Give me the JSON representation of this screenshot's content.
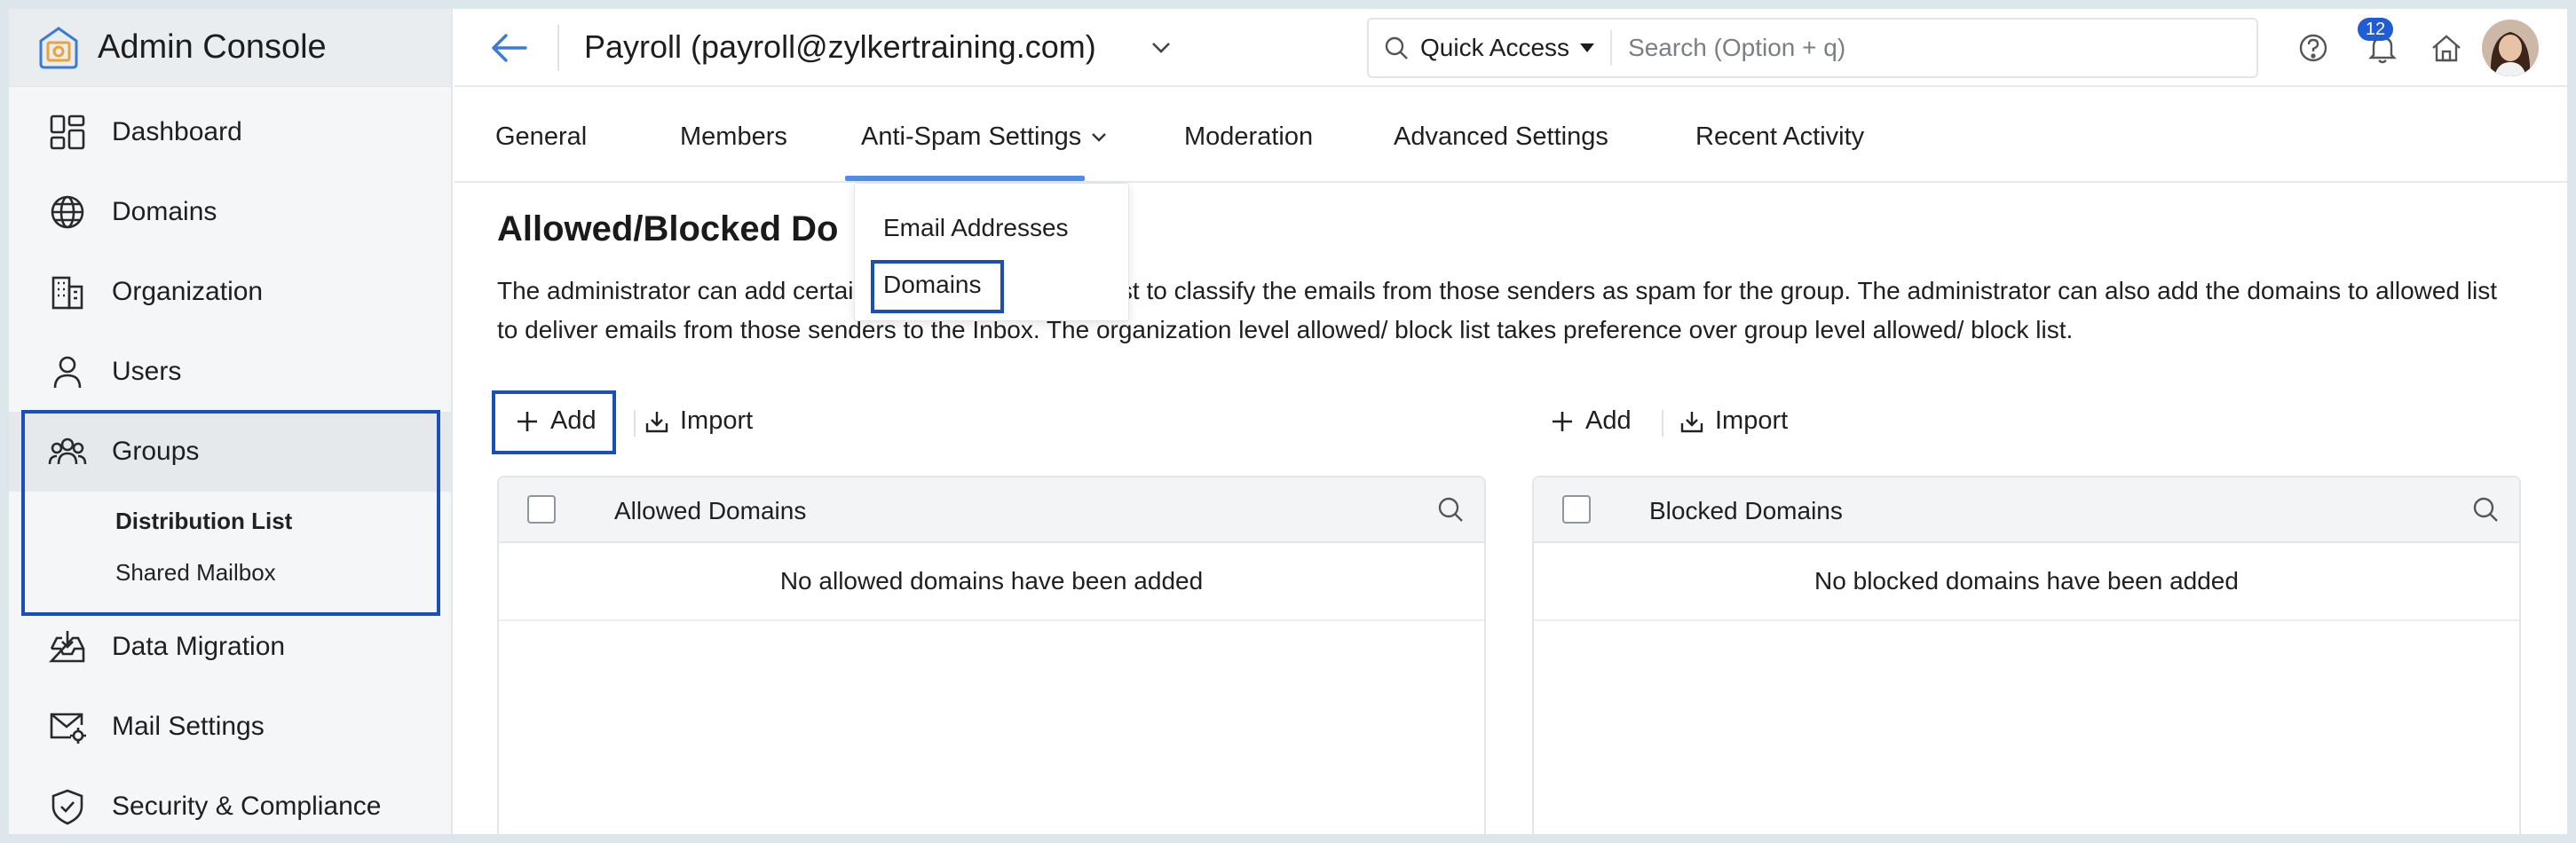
{
  "app": {
    "title": "Admin Console"
  },
  "sidebar": {
    "items": [
      {
        "label": "Dashboard",
        "icon": "dashboard-icon"
      },
      {
        "label": "Domains",
        "icon": "globe-icon"
      },
      {
        "label": "Organization",
        "icon": "building-icon"
      },
      {
        "label": "Users",
        "icon": "user-icon"
      },
      {
        "label": "Groups",
        "icon": "groups-icon",
        "active": true
      },
      {
        "label": "Data Migration",
        "icon": "inbox-download-icon"
      },
      {
        "label": "Mail Settings",
        "icon": "mail-settings-icon"
      },
      {
        "label": "Security & Compliance",
        "icon": "shield-icon"
      }
    ],
    "groups_sub": [
      {
        "label": "Distribution List",
        "selected": true
      },
      {
        "label": "Shared Mailbox"
      }
    ]
  },
  "header": {
    "group_title": "Payroll (payroll@zylkertraining.com)",
    "quick_access": "Quick Access",
    "search_placeholder": "Search (Option + q)",
    "notification_count": "12",
    "icons": [
      "back-arrow-icon",
      "help-icon",
      "bell-icon",
      "home-icon",
      "avatar"
    ]
  },
  "tabs": [
    {
      "label": "General"
    },
    {
      "label": "Members"
    },
    {
      "label": "Anti-Spam Settings",
      "active": true
    },
    {
      "label": "Moderation"
    },
    {
      "label": "Advanced Settings"
    },
    {
      "label": "Recent Activity"
    }
  ],
  "dropdown": {
    "items": [
      {
        "label": "Email Addresses"
      },
      {
        "label": "Domains",
        "selected": true
      }
    ]
  },
  "content": {
    "title": "Allowed/Blocked Do",
    "description": "The administrator can add certain domains to the block list to classify the emails from those senders as spam for the group. The administrator can also add the domains to allowed list to deliver emails from those senders to the Inbox. The organization level allowed/ block list takes preference over group level allowed/ block list.",
    "allowed": {
      "add_label": "Add",
      "import_label": "Import",
      "header": "Allowed Domains",
      "empty": "No allowed domains have been added"
    },
    "blocked": {
      "add_label": "Add",
      "import_label": "Import",
      "header": "Blocked Domains",
      "empty": "No blocked domains have been added"
    }
  },
  "colors": {
    "accent": "#1f5cd6",
    "highlight_box": "#1a4fb6",
    "tab_underline": "#4f8de8",
    "sidebar_bg": "#f4f6f8",
    "logo_orange": "#e8a33a"
  }
}
